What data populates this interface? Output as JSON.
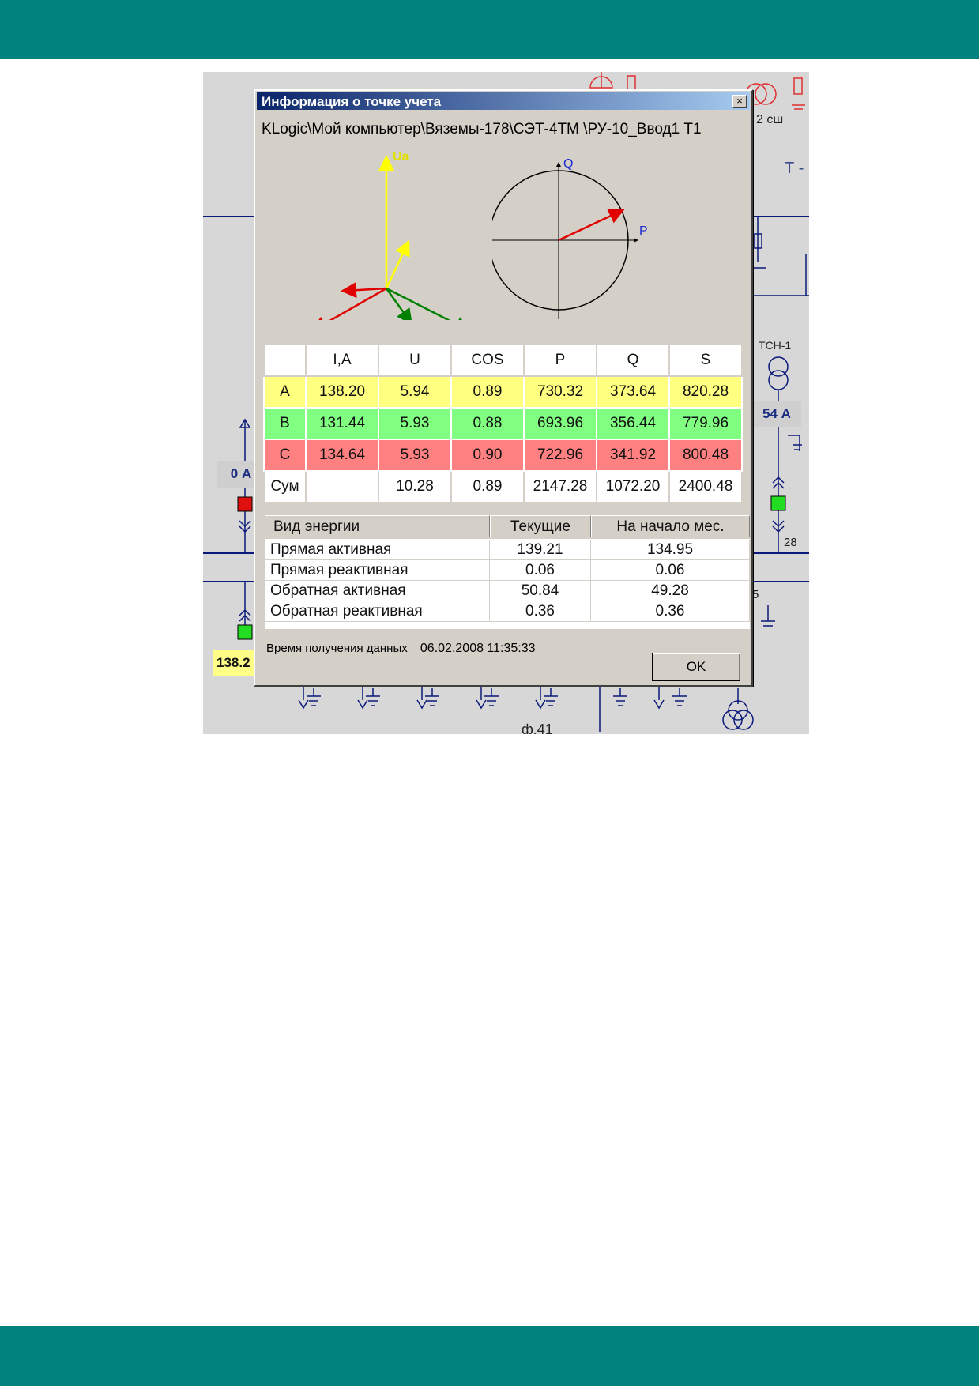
{
  "schematic": {
    "label_2sh": "2 сш",
    "label_t": "Т -",
    "label_tsn": "ТСН-1",
    "current_left": "0 А",
    "current_right": "54 А",
    "label_28": "28",
    "label_5": "5",
    "current_yellow": "138.2",
    "label_feeder": "ф.41"
  },
  "dialog": {
    "title": "Информация о точке учета",
    "close_symbol": "×",
    "path": "KLogic\\Мой компьютер\\Вяземы-178\\СЭТ-4ТМ \\РУ-10_Ввод1 Т1",
    "vectors": {
      "ua": "Ua",
      "ub": "Ub",
      "uc": "Uc",
      "color_a": "#ffff00",
      "color_b": "#008000",
      "color_c": "#e00000"
    },
    "pq": {
      "q": "Q",
      "p": "P"
    },
    "phase_table": {
      "headers": [
        "",
        "I,A",
        "U",
        "COS",
        "P",
        "Q",
        "S"
      ],
      "rows": [
        [
          "A",
          "138.20",
          "5.94",
          "0.89",
          "730.32",
          "373.64",
          "820.28"
        ],
        [
          "B",
          "131.44",
          "5.93",
          "0.88",
          "693.96",
          "356.44",
          "779.96"
        ],
        [
          "C",
          "134.64",
          "5.93",
          "0.90",
          "722.96",
          "341.92",
          "800.48"
        ],
        [
          "Сум",
          "",
          "10.28",
          "0.89",
          "2147.28",
          "1072.20",
          "2400.48"
        ]
      ]
    },
    "energy_table": {
      "headers": [
        "Вид энергии",
        "Текущие",
        "На начало мес."
      ],
      "rows": [
        [
          "Прямая активная",
          "139.21",
          "134.95"
        ],
        [
          "Прямая реактивная",
          "0.06",
          "0.06"
        ],
        [
          "Обратная активная",
          "50.84",
          "49.28"
        ],
        [
          "Обратная реактивная",
          "0.36",
          "0.36"
        ]
      ]
    },
    "timestamp_label": "Время получения данных",
    "timestamp_value": "06.02.2008 11:35:33",
    "ok": "OK"
  }
}
